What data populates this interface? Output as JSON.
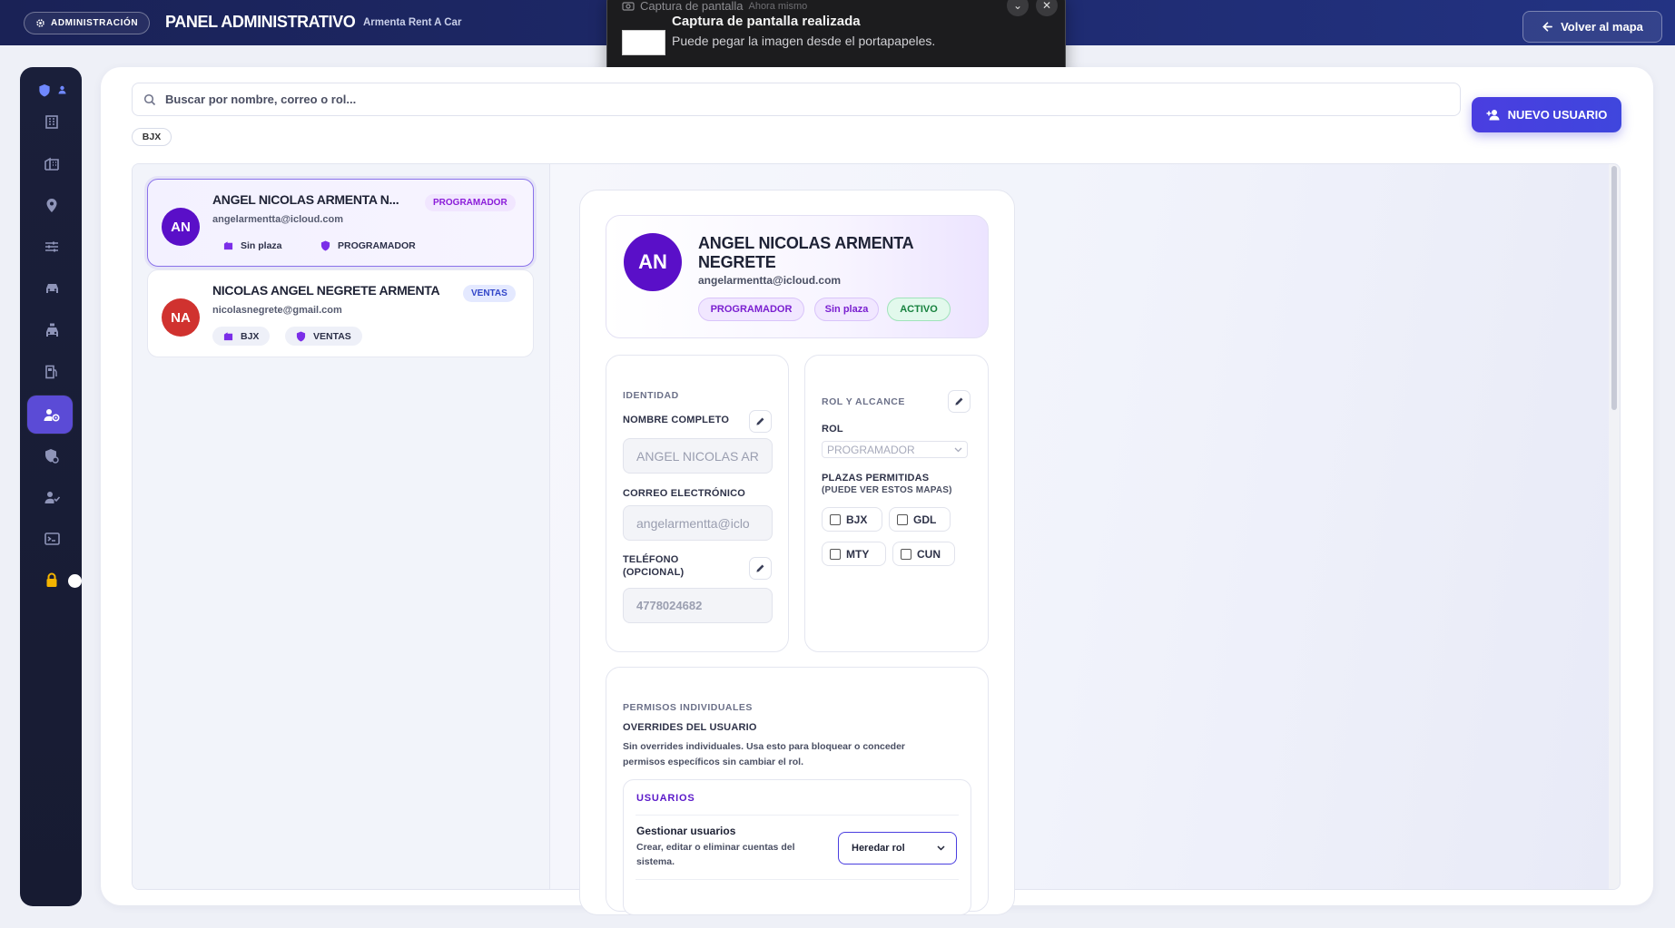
{
  "topbar": {
    "admin_badge": "ADMINISTRACIÓN",
    "title": "PANEL ADMINISTRATIVO",
    "subtitle": "Armenta Rent A Car",
    "back_button": "Volver al mapa",
    "background": "#1e2a6e"
  },
  "notification": {
    "app": "Captura de pantalla",
    "time": "Ahora mismo",
    "title": "Captura de pantalla realizada",
    "body": "Puede pegar la imagen desde el portapapeles."
  },
  "sidebar": {
    "icons": [
      "shield-icon",
      "building-icon",
      "buildings-icon",
      "location-pin-icon",
      "sliders-icon",
      "car-icon",
      "taxi-icon",
      "fuel-icon",
      "users-admin-icon",
      "security-icon",
      "user-check-icon",
      "terminal-icon",
      "lock-icon"
    ],
    "active_item": "users-admin-icon",
    "accent": "#5b4bd6"
  },
  "search": {
    "placeholder": "Buscar por nombre, correo o rol..."
  },
  "new_user_button": "NUEVO USUARIO",
  "filter_chip": "BJX",
  "users": [
    {
      "initials": "AN",
      "name": "ANGEL NICOLAS ARMENTA N...",
      "email": "angelarmentta@icloud.com",
      "role_badge": "PROGRAMADOR",
      "plaza": "Sin plaza",
      "role": "PROGRAMADOR",
      "avatar_color": "#5a0fc8",
      "selected": true
    },
    {
      "initials": "NA",
      "name": "NICOLAS ANGEL NEGRETE ARMENTA",
      "email": "nicolasnegrete@gmail.com",
      "role_badge": "VENTAS",
      "plaza": "BJX",
      "role": "VENTAS",
      "avatar_color": "#d0322f",
      "selected": false
    }
  ],
  "detail": {
    "initials": "AN",
    "name": "ANGEL NICOLAS ARMENTA NEGRETE",
    "email": "angelarmentta@icloud.com",
    "badges": {
      "role": "PROGRAMADOR",
      "plaza": "Sin plaza",
      "status": "ACTIVO"
    },
    "identity": {
      "section": "IDENTIDAD",
      "name_label": "NOMBRE COMPLETO",
      "name_value": "ANGEL NICOLAS AR",
      "email_label": "CORREO ELECTRÓNICO",
      "email_value": "angelarmentta@iclo",
      "phone_label_1": "TELÉFONO",
      "phone_label_2": "(OPCIONAL)",
      "phone_value": "4778024682"
    },
    "role_scope": {
      "section": "ROL Y ALCANCE",
      "role_label": "ROL",
      "role_value": "PROGRAMADOR",
      "plazas_label": "PLAZAS PERMITIDAS",
      "plazas_sub": "(PUEDE VER ESTOS MAPAS)",
      "plazas": [
        "BJX",
        "GDL",
        "MTY",
        "CUN"
      ]
    },
    "permissions": {
      "section": "PERMISOS INDIVIDUALES",
      "title": "OVERRIDES DEL USUARIO",
      "desc_1": "Sin overrides individuales. Usa esto para bloquear o conceder",
      "desc_2": "permisos específicos sin cambiar el rol.",
      "group": "USUARIOS",
      "item_title": "Gestionar usuarios",
      "item_desc_1": "Crear, editar o eliminar cuentas del",
      "item_desc_2": "sistema.",
      "item_value": "Heredar rol"
    }
  }
}
